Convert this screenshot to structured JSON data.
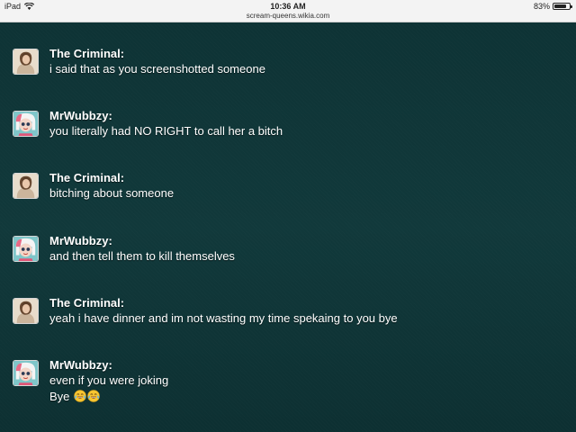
{
  "status_bar": {
    "device": "iPad",
    "time": "10:36 AM",
    "url": "scream-queens.wikia.com",
    "battery_text": "83%",
    "battery_level": 0.83
  },
  "messages": [
    {
      "user": "The Criminal:",
      "avatar": "criminal-avatar",
      "lines": [
        "i said that as you screenshotted someone"
      ]
    },
    {
      "user": "MrWubbzy:",
      "avatar": "wubbzy-avatar",
      "lines": [
        "you literally had NO RIGHT to call her a bitch"
      ]
    },
    {
      "user": "The Criminal:",
      "avatar": "criminal-avatar",
      "lines": [
        "bitching about someone"
      ]
    },
    {
      "user": "MrWubbzy:",
      "avatar": "wubbzy-avatar",
      "lines": [
        "and then tell them to kill themselves"
      ]
    },
    {
      "user": "The Criminal:",
      "avatar": "criminal-avatar",
      "lines": [
        "yeah i have dinner and im not wasting my time spekaing to you bye"
      ]
    },
    {
      "user": "MrWubbzy:",
      "avatar": "wubbzy-avatar",
      "lines": [
        "even if you were joking",
        "Bye"
      ]
    }
  ],
  "icons": {
    "wifi": "wifi-icon",
    "battery": "battery-icon",
    "emoji": "face-with-tears-of-joy-icon"
  },
  "colors": {
    "background": "#0f3436",
    "text": "#ffffff",
    "status_bar": "#f3f3f3"
  }
}
